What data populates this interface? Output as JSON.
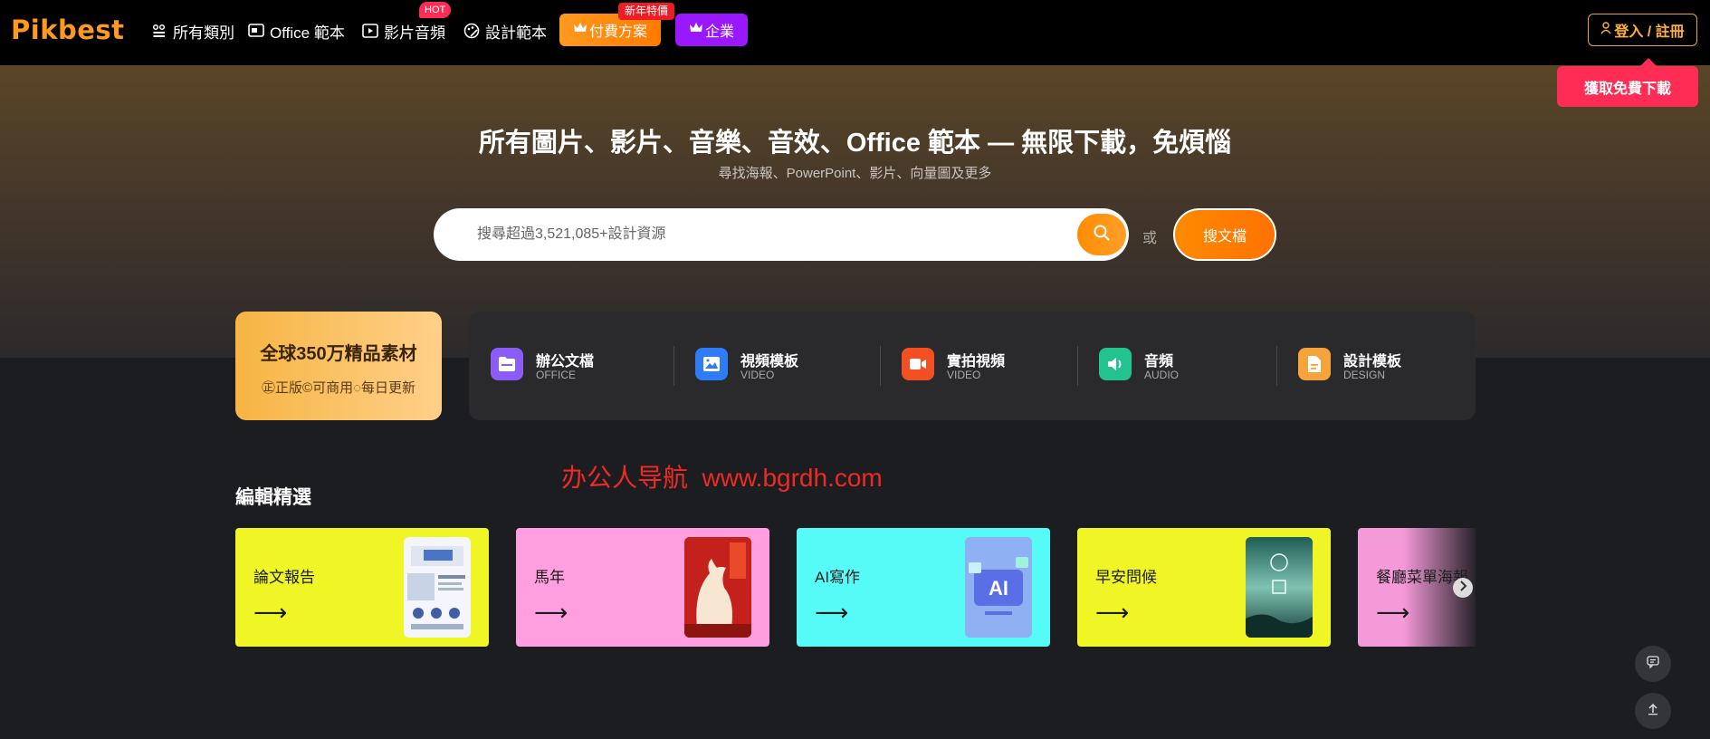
{
  "header": {
    "logo": "Pikbest",
    "nav": [
      {
        "label": "所有類別",
        "icon": "grid-icon"
      },
      {
        "label": "Office 範本",
        "icon": "office-icon"
      },
      {
        "label": "影片音頻",
        "icon": "video-icon"
      },
      {
        "label": "設計範本",
        "icon": "palette-icon"
      }
    ],
    "hot_badge": "HOT",
    "paid_plan": "付費方案",
    "newyear_badge": "新年特價",
    "enterprise": "企業",
    "login": "登入 / 註冊",
    "free_download_tip": "獲取免費下載"
  },
  "hero": {
    "title": "所有圖片、影片、音樂、音效、Office 範本 — 無限下載，免煩惱",
    "subtitle": "尋找海報、PowerPoint、影片、向量圖及更多",
    "search_placeholder": "搜尋超過3,521,085+設計資源",
    "or": "或",
    "doc_search": "搜文檔"
  },
  "promo": {
    "title": "全球350万精品素材",
    "subtitle": "㊣正版©可商用◌每日更新"
  },
  "categories": [
    {
      "name": "辦公文檔",
      "en": "OFFICE",
      "icon": "folder-icon",
      "color": "#8b5cf6"
    },
    {
      "name": "視頻模板",
      "en": "VIDEO",
      "icon": "image-icon",
      "color": "#2f7cf6"
    },
    {
      "name": "實拍視頻",
      "en": "VIDEO",
      "icon": "camera-icon",
      "color": "#f25022"
    },
    {
      "name": "音頻",
      "en": "AUDIO",
      "icon": "speaker-icon",
      "color": "#22c38e"
    },
    {
      "name": "設計模板",
      "en": "DESIGN",
      "icon": "document-icon",
      "color": "#f5a33a"
    }
  ],
  "watermark": "办公人导航  www.bgrdh.com",
  "editor_picks": {
    "title": "編輯精選",
    "arrow": "⟶",
    "cards": [
      {
        "label": "論文報告",
        "color": "#f0f526"
      },
      {
        "label": "馬年",
        "color": "#ff9fe0"
      },
      {
        "label": "AI寫作",
        "color": "#56fbf8"
      },
      {
        "label": "早安問候",
        "color": "#f0f526"
      },
      {
        "label": "餐廳菜單海報",
        "color": "#f59ad9"
      }
    ]
  }
}
